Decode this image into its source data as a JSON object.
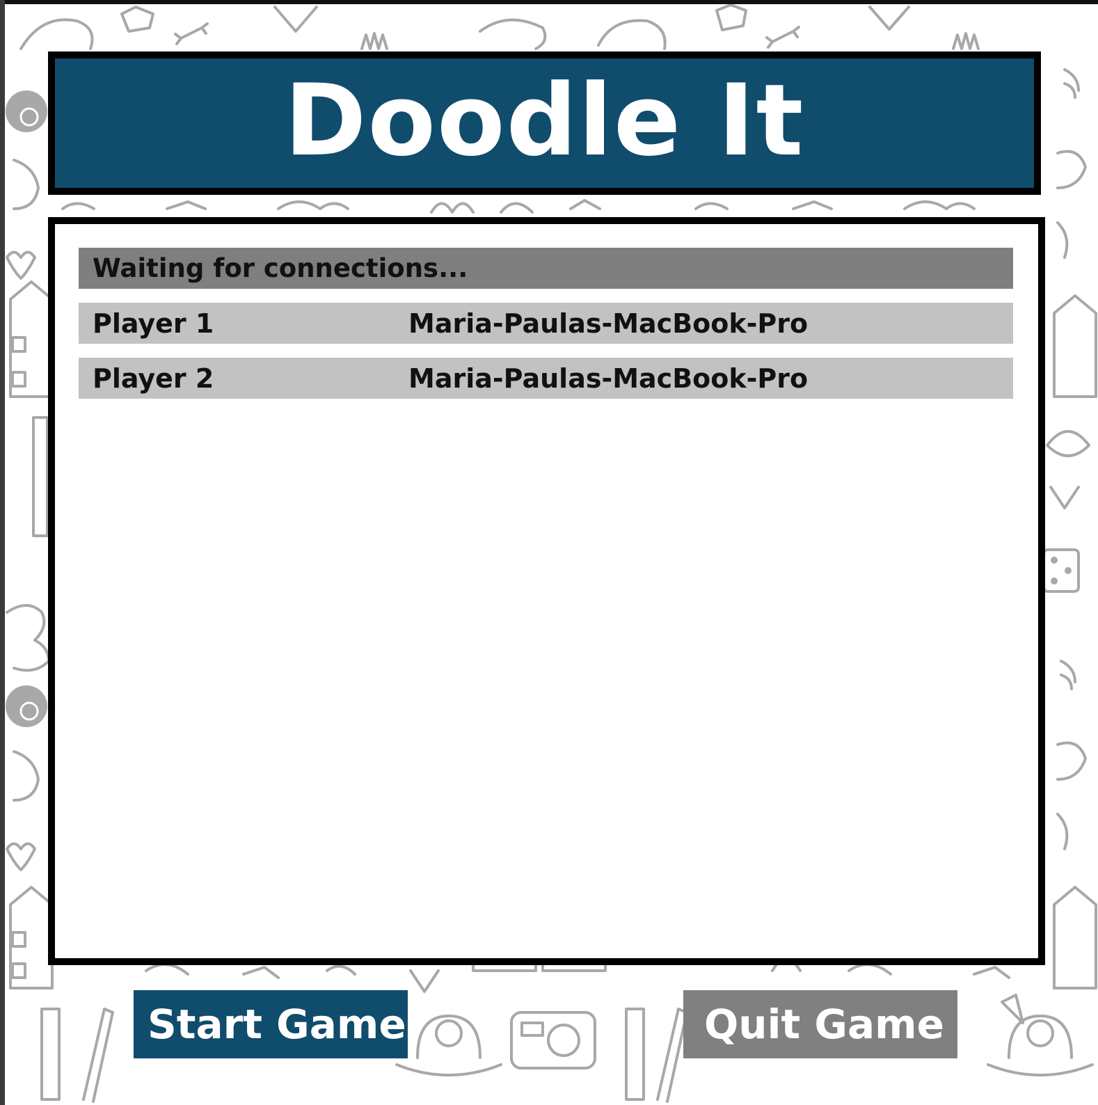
{
  "title": "Doodle It",
  "status": "Waiting for connections...",
  "players": [
    {
      "label": "Player 1",
      "host": "Maria-Paulas-MacBook-Pro"
    },
    {
      "label": "Player 2",
      "host": "Maria-Paulas-MacBook-Pro"
    }
  ],
  "buttons": {
    "start": "Start Game",
    "quit": "Quit Game"
  },
  "colors": {
    "brand": "#104c6c",
    "quit": "#808080",
    "status_bar": "#7f7f7f",
    "player_row": "#c2c2c2",
    "doodle_lines": "#a8a8a8"
  }
}
